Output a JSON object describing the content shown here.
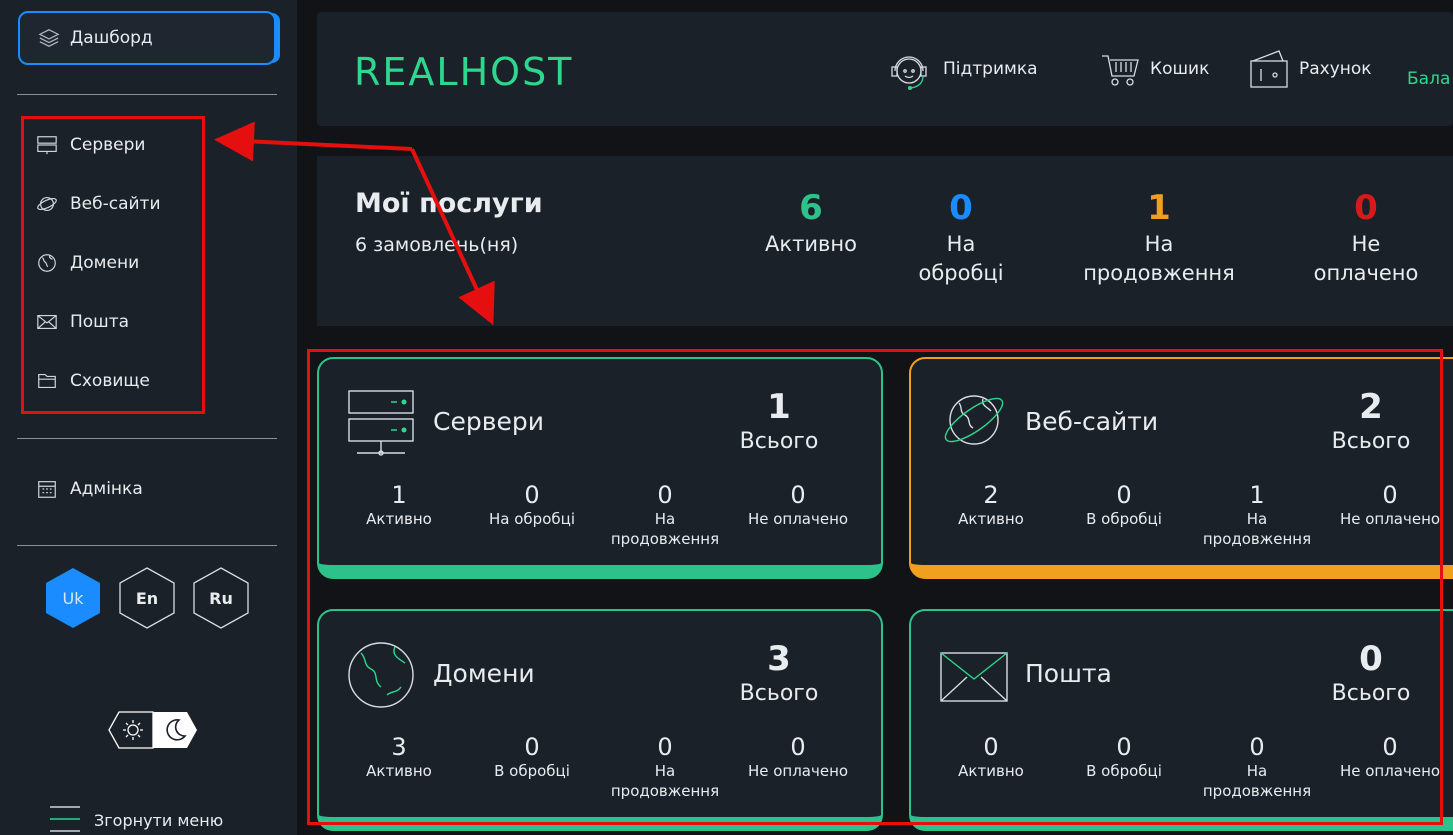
{
  "sidebar": {
    "dashboard": "Дашборд",
    "items": [
      {
        "label": "Сервери",
        "icon": "server-icon"
      },
      {
        "label": "Веб-сайти",
        "icon": "planet-icon"
      },
      {
        "label": "Домени",
        "icon": "globe-icon"
      },
      {
        "label": "Пошта",
        "icon": "mail-icon"
      },
      {
        "label": "Сховище",
        "icon": "storage-icon"
      }
    ],
    "admin": "Адмінка",
    "languages": [
      "Uk",
      "En",
      "Ru"
    ],
    "active_language": "Uk",
    "collapse": "Згорнути меню"
  },
  "header": {
    "logo": "REALHOST",
    "support": "Підтримка",
    "cart": "Кошик",
    "invoice": "Рахунок",
    "balance": "Бала"
  },
  "services": {
    "title": "Мої послуги",
    "subtitle": "6 замовлень(ня)",
    "stats": [
      {
        "num": "6",
        "label": "Активно",
        "color": "#2dc28a"
      },
      {
        "num": "0",
        "label": "На обробці",
        "color": "#1a8cff"
      },
      {
        "num": "1",
        "label": "На продовження",
        "color": "#f0a01e"
      },
      {
        "num": "0",
        "label": "Не оплачено",
        "color": "#d41a1a"
      }
    ]
  },
  "cards": [
    {
      "title": "Сервери",
      "total": "1",
      "total_label": "Всього",
      "color": "#2dc28a",
      "stats": [
        {
          "n": "1",
          "l": "Активно"
        },
        {
          "n": "0",
          "l": "На обробці"
        },
        {
          "n": "0",
          "l": "На продовження"
        },
        {
          "n": "0",
          "l": "Не оплачено"
        }
      ]
    },
    {
      "title": "Веб-сайти",
      "total": "2",
      "total_label": "Всього",
      "color": "#f0a01e",
      "stats": [
        {
          "n": "2",
          "l": "Активно"
        },
        {
          "n": "0",
          "l": "В обробці"
        },
        {
          "n": "1",
          "l": "На продовження"
        },
        {
          "n": "0",
          "l": "Не оплачено"
        }
      ]
    },
    {
      "title": "Домени",
      "total": "3",
      "total_label": "Всього",
      "color": "#2dc28a",
      "stats": [
        {
          "n": "3",
          "l": "Активно"
        },
        {
          "n": "0",
          "l": "В обробці"
        },
        {
          "n": "0",
          "l": "На продовження"
        },
        {
          "n": "0",
          "l": "Не оплачено"
        }
      ]
    },
    {
      "title": "Пошта",
      "total": "0",
      "total_label": "Всього",
      "color": "#2dc28a",
      "stats": [
        {
          "n": "0",
          "l": "Активно"
        },
        {
          "n": "0",
          "l": "В обробці"
        },
        {
          "n": "0",
          "l": "На продовження"
        },
        {
          "n": "0",
          "l": "Не оплачено"
        }
      ]
    }
  ],
  "colors": {
    "accent": "#2dd88e",
    "blue": "#1a8cff",
    "annotation": "#e50f0f"
  }
}
